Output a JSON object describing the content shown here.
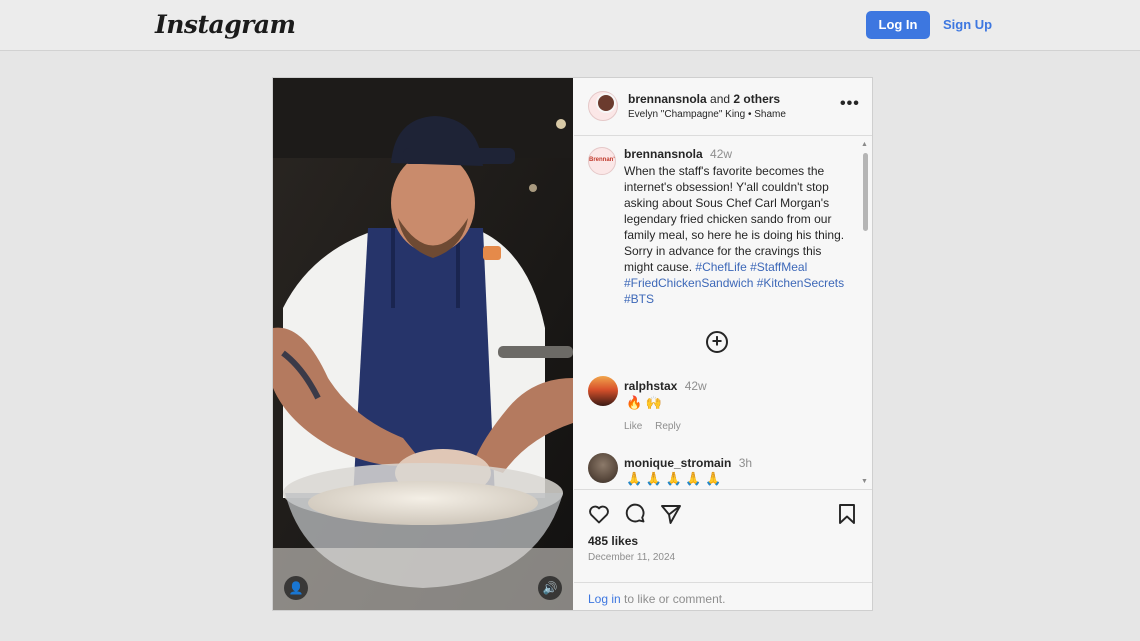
{
  "nav": {
    "logo": "Instagram",
    "login": "Log In",
    "signup": "Sign Up"
  },
  "post": {
    "header": {
      "username": "brennansnola",
      "and": "and",
      "others": "2 others",
      "audio": "Evelyn \"Champagne\" King • Shame"
    },
    "caption": {
      "brand_mark": "Brennan's",
      "username": "brennansnola",
      "time": "42w",
      "text": "When the staff's favorite becomes the internet's obsession! Y'all couldn't stop asking about Sous Chef Carl Morgan's legendary fried chicken sando from our family meal, so here he is doing his thing. Sorry in advance for the cravings this might cause.",
      "hashtags": [
        "#ChefLife",
        "#StaffMeal",
        "#FriedChickenSandwich",
        "#KitchenSecrets",
        "#BTS"
      ]
    },
    "comments": [
      {
        "username": "ralphstax",
        "time": "42w",
        "text": "🔥 🙌",
        "like": "Like",
        "reply": "Reply"
      },
      {
        "username": "monique_stromain",
        "time": "3h",
        "text": "🙏 🙏 🙏 🙏 🙏"
      }
    ],
    "likes": "485 likes",
    "date": "December 11, 2024",
    "login_prompt": {
      "link": "Log in",
      "rest": " to like or comment."
    }
  },
  "icons": {
    "heart": "heart-icon",
    "comment": "comment-icon",
    "share": "share-icon",
    "save": "bookmark-icon",
    "more": "more-icon",
    "plus": "plus-circle-icon",
    "user": "user-tag-icon",
    "audio": "audio-icon"
  }
}
